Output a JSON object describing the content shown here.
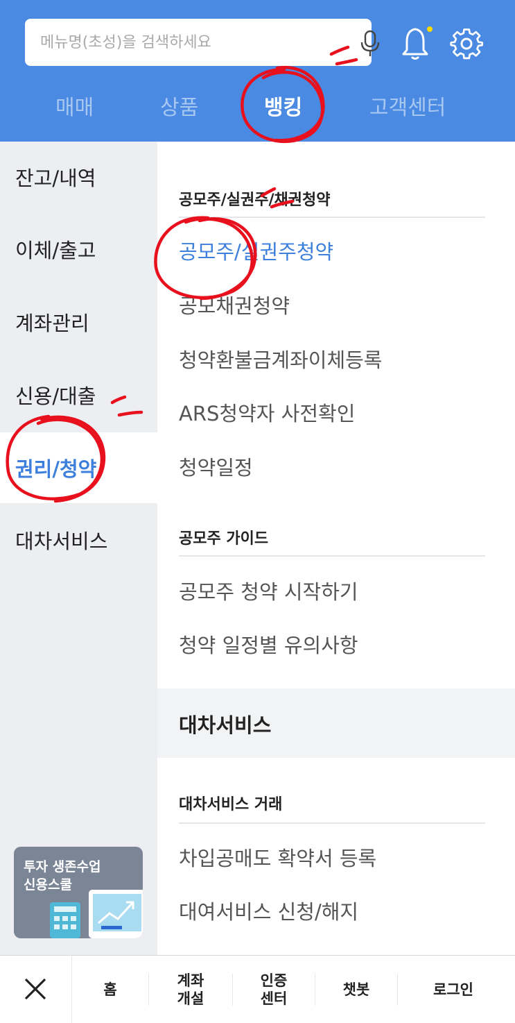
{
  "search": {
    "placeholder": "메뉴명(초성)을 검색하세요"
  },
  "header_icons": {
    "mic": "microphone-icon",
    "bell": "bell-icon",
    "settings": "gear-icon",
    "notify_dot_color": "#f5d90a"
  },
  "tabs": [
    {
      "label": "매매",
      "active": false
    },
    {
      "label": "상품",
      "active": false
    },
    {
      "label": "뱅킹",
      "active": true
    },
    {
      "label": "고객센터",
      "active": false
    }
  ],
  "sidebar": {
    "items": [
      {
        "label": "잔고/내역",
        "active": false
      },
      {
        "label": "이체/출고",
        "active": false
      },
      {
        "label": "계좌관리",
        "active": false
      },
      {
        "label": "신용/대출",
        "active": false
      },
      {
        "label": "권리/청약",
        "active": true
      },
      {
        "label": "대차서비스",
        "active": false
      }
    ],
    "promo": {
      "text": "투자 생존수업\n신용스쿨"
    }
  },
  "content": {
    "sections": [
      {
        "title": "공모주/실권주/채권청약",
        "links": [
          {
            "label": "공모주/실권주청약",
            "active": true
          },
          {
            "label": "공모채권청약",
            "active": false
          },
          {
            "label": "청약환불금계좌이체등록",
            "active": false
          },
          {
            "label": "ARS청약자 사전확인",
            "active": false
          },
          {
            "label": "청약일정",
            "active": false
          }
        ]
      },
      {
        "title": "공모주 가이드",
        "links": [
          {
            "label": "공모주 청약 시작하기",
            "active": false
          },
          {
            "label": "청약 일정별 유의사항",
            "active": false
          }
        ]
      }
    ],
    "group_title": "대차서비스",
    "group_section": {
      "title": "대차서비스 거래",
      "links": [
        {
          "label": "차입공매도 확약서 등록",
          "active": false
        },
        {
          "label": "대여서비스 신청/해지",
          "active": false
        }
      ]
    }
  },
  "bottom_nav": {
    "close_icon": "close-icon",
    "items": [
      "홈",
      "계좌\n개설",
      "인증\n센터",
      "챗봇",
      "로그인"
    ]
  },
  "colors": {
    "header_bg": "#4a8ae2",
    "accent": "#3d7fdc",
    "annotation": "#e8101c"
  }
}
